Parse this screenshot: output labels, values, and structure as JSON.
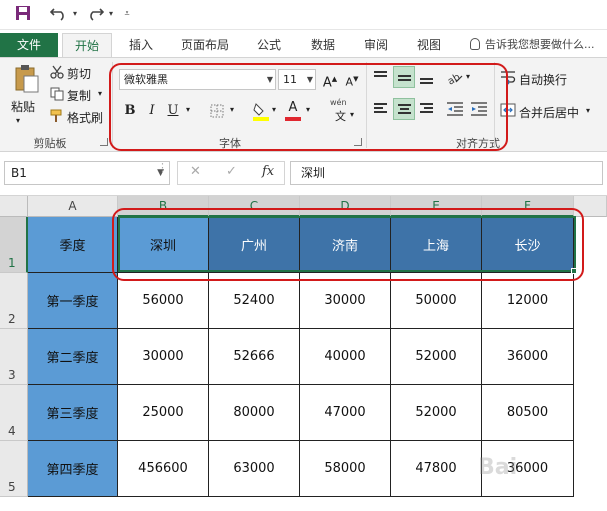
{
  "qat": {
    "save": "save-icon",
    "undo": "undo-icon",
    "redo": "redo-icon",
    "customize": "customize-icon"
  },
  "tabs": {
    "file": "文件",
    "items": [
      "开始",
      "插入",
      "页面布局",
      "公式",
      "数据",
      "审阅",
      "视图"
    ],
    "tell_me": "告诉我您想要做什么..."
  },
  "ribbon": {
    "clipboard": {
      "paste": "粘贴",
      "cut": "剪切",
      "copy": "复制",
      "format_painter": "格式刷",
      "label": "剪贴板"
    },
    "font": {
      "font_name": "微软雅黑",
      "font_size": "11",
      "bold": "B",
      "italic": "I",
      "underline": "U",
      "font_color": "A",
      "wen": "wén",
      "wen_char": "文",
      "grow": "A",
      "shrink": "A",
      "label": "字体"
    },
    "alignment": {
      "wrap_text": "自动换行",
      "merge_center": "合并后居中",
      "label": "对齐方式"
    }
  },
  "formula_bar": {
    "name_box": "B1",
    "cancel": "✕",
    "enter": "✓",
    "fx": "fx",
    "value": "深圳"
  },
  "grid": {
    "columns": [
      "A",
      "B",
      "C",
      "D",
      "E",
      "F"
    ],
    "rows": [
      "1",
      "2",
      "3",
      "4",
      "5"
    ],
    "header_row": [
      "季度",
      "深圳",
      "广州",
      "济南",
      "上海",
      "长沙"
    ],
    "data": [
      [
        "第一季度",
        "56000",
        "52400",
        "30000",
        "50000",
        "12000"
      ],
      [
        "第二季度",
        "30000",
        "52666",
        "40000",
        "52000",
        "36000"
      ],
      [
        "第三季度",
        "25000",
        "80000",
        "47000",
        "52000",
        "80500"
      ],
      [
        "第四季度",
        "456600",
        "63000",
        "58000",
        "47800",
        "36000"
      ]
    ]
  },
  "colors": {
    "accent": "#217346",
    "quarter_fill": "#5b9bd5",
    "city_fill": "#3e73a8",
    "highlight": "#d21a1a"
  },
  "watermark": "Bai"
}
